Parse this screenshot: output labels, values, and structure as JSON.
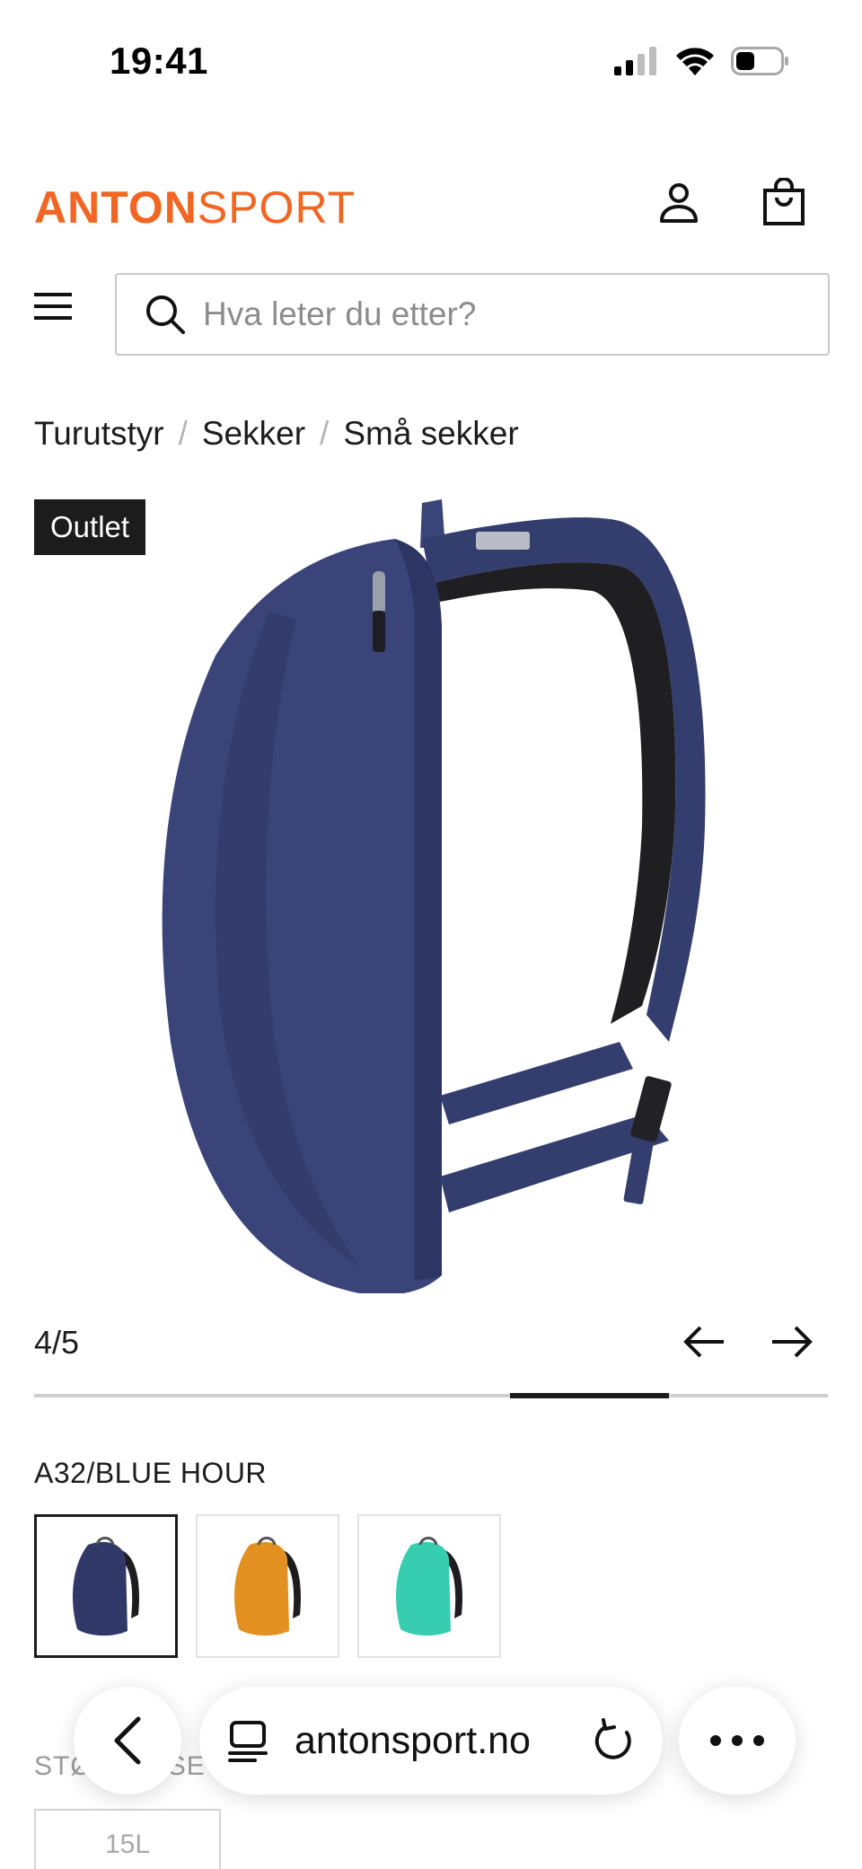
{
  "status_bar": {
    "time": "19:41"
  },
  "header": {
    "logo_bold": "ANTON",
    "logo_light": "SPORT",
    "brand_color": "#f26522",
    "account_icon": "person-icon",
    "cart_icon": "shopping-bag-icon"
  },
  "search": {
    "placeholder": "Hva leter du etter?"
  },
  "breadcrumb": {
    "items": [
      "Turutstyr",
      "Sekker",
      "Små sekker"
    ],
    "separator": "/"
  },
  "product": {
    "badge": "Outlet",
    "gallery": {
      "counter": "4/5",
      "current": 4,
      "total": 5
    },
    "color_label": "A32/BLUE HOUR",
    "swatches": [
      {
        "name": "Blue Hour",
        "color": "#2f3866",
        "selected": true
      },
      {
        "name": "Orange",
        "color": "#e2901f",
        "selected": false
      },
      {
        "name": "Teal",
        "color": "#37cdb0",
        "selected": false
      }
    ],
    "size_label": "STØRRELSE",
    "sizes": [
      "15L"
    ]
  },
  "browser": {
    "url": "antonsport.no"
  }
}
